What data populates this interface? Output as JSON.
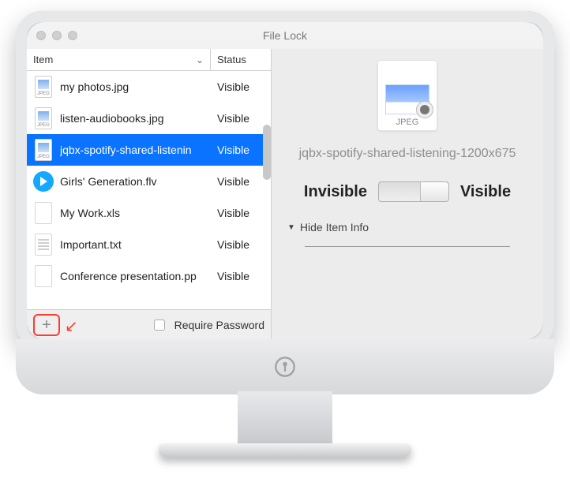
{
  "window": {
    "title": "File Lock"
  },
  "columns": {
    "item": "Item",
    "status": "Status"
  },
  "rows": [
    {
      "name": "my photos.jpg",
      "status": "Visible",
      "icon": "jpeg",
      "selected": false
    },
    {
      "name": "listen-audiobooks.jpg",
      "status": "Visible",
      "icon": "jpeg",
      "selected": false
    },
    {
      "name": "jqbx-spotify-shared-listenin",
      "status": "Visible",
      "icon": "jpeg",
      "selected": true
    },
    {
      "name": "Girls' Generation.flv",
      "status": "Visible",
      "icon": "flv",
      "selected": false
    },
    {
      "name": "My Work.xls",
      "status": "Visible",
      "icon": "blank",
      "selected": false
    },
    {
      "name": "Important.txt",
      "status": "Visible",
      "icon": "txt",
      "selected": false
    },
    {
      "name": "Conference presentation.pp",
      "status": "Visible",
      "icon": "blank",
      "selected": false
    }
  ],
  "footer": {
    "require_password": "Require Password"
  },
  "detail": {
    "file_type_label": "JPEG",
    "file_name": "jqbx-spotify-shared-listening-1200x675",
    "toggle_left": "Invisible",
    "toggle_right": "Visible",
    "toggle_state": "visible",
    "disclosure": "Hide Item Info"
  }
}
